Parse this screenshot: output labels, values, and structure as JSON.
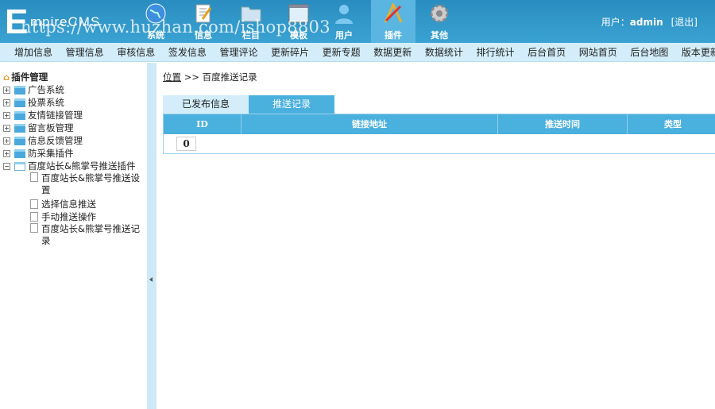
{
  "header": {
    "logo_initial": "E",
    "logo_rest": "mpireCMS",
    "nav": [
      {
        "label": "系统",
        "icon": "globe-icon"
      },
      {
        "label": "信息",
        "icon": "notepad-icon"
      },
      {
        "label": "栏目",
        "icon": "folder-icon"
      },
      {
        "label": "模板",
        "icon": "window-icon"
      },
      {
        "label": "用户",
        "icon": "user-icon"
      },
      {
        "label": "插件",
        "icon": "tools-icon",
        "active": true
      },
      {
        "label": "其他",
        "icon": "gear-icon"
      }
    ],
    "user_label": "用户：",
    "username": "admin",
    "logout": "[退出]"
  },
  "menu": [
    "增加信息",
    "管理信息",
    "审核信息",
    "签发信息",
    "管理评论",
    "更新碎片",
    "更新专题",
    "数据更新",
    "数据统计",
    "排行统计",
    "后台首页",
    "网站首页",
    "后台地图",
    "版本更新"
  ],
  "sidebar": {
    "title": "插件管理",
    "folders": [
      "广告系统",
      "投票系统",
      "友情链接管理",
      "留言板管理",
      "信息反馈管理",
      "防采集插件"
    ],
    "open_folder": "百度站长&熊掌号推送插件",
    "children": [
      "百度站长&熊掌号推送设置",
      "选择信息推送",
      "手动推送操作",
      "百度站长&熊掌号推送记录"
    ]
  },
  "main": {
    "crumb_label": "位置",
    "crumb_sep": ">>",
    "crumb_page": "百度推送记录",
    "tabs": [
      "已发布信息",
      "推送记录"
    ],
    "columns": [
      "ID",
      "链接地址",
      "推送时间",
      "类型"
    ],
    "row_id": "0"
  },
  "watermark": "https://www.huzhan.com/ishop8803"
}
